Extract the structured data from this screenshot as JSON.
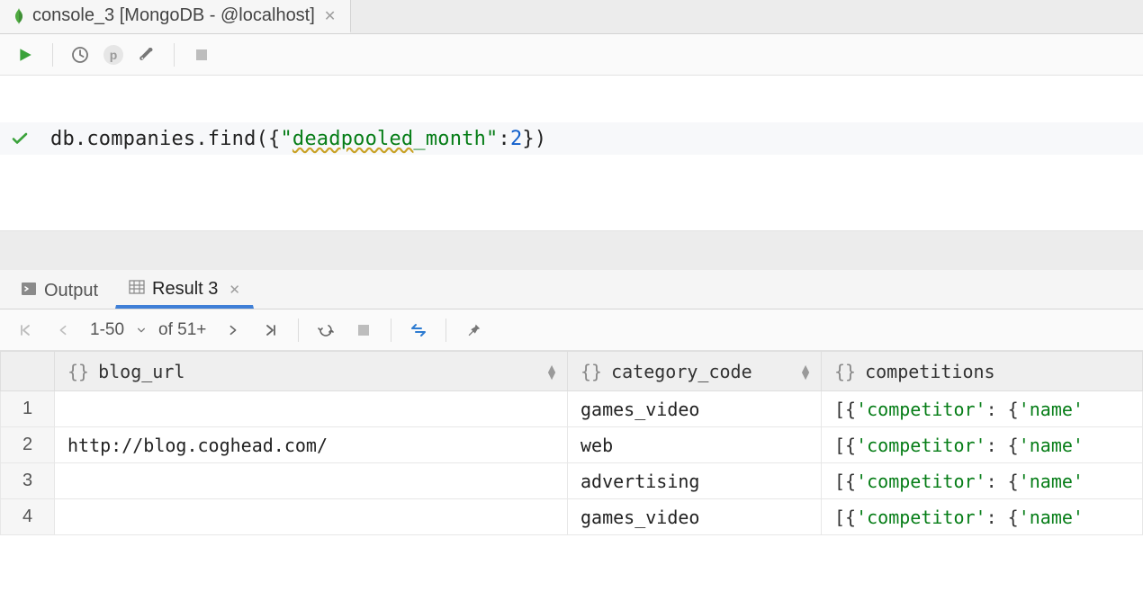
{
  "tab": {
    "title": "console_3 [MongoDB - @localhost]"
  },
  "toolbar": {
    "p_label": "p"
  },
  "editor": {
    "line": {
      "prefix": "db.companies.find({",
      "str_open": "\"",
      "typo_part": "deadpooled",
      "rest_key": "_month",
      "str_close": "\"",
      "colon": ":",
      "number": "2",
      "suffix": "})"
    }
  },
  "outputTabs": {
    "output_label": "Output",
    "result_label": "Result 3"
  },
  "resultsToolbar": {
    "page_range": "1-50",
    "of_label": "of 51+"
  },
  "table": {
    "columns": {
      "blog_url": "blog_url",
      "category_code": "category_code",
      "competitions": "competitions"
    },
    "rows": [
      {
        "n": "1",
        "blog_url": "",
        "category_code": "games_video",
        "comp_visible": "[{'competitor': {'name'"
      },
      {
        "n": "2",
        "blog_url": "http://blog.coghead.com/",
        "category_code": "web",
        "comp_visible": "[{'competitor': {'name'"
      },
      {
        "n": "3",
        "blog_url": "",
        "category_code": "advertising",
        "comp_visible": "[{'competitor': {'name'"
      },
      {
        "n": "4",
        "blog_url": "",
        "category_code": "games_video",
        "comp_visible": "[{'competitor': {'name'"
      }
    ]
  }
}
